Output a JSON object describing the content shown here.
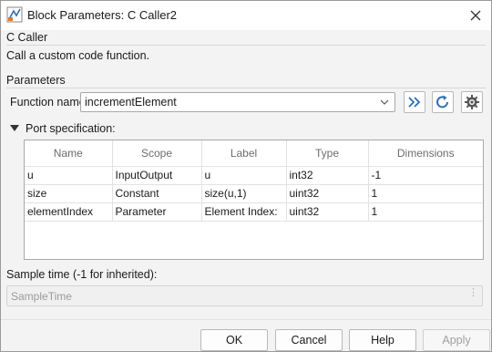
{
  "window": {
    "title": "Block Parameters: C Caller2"
  },
  "header": {
    "block_name": "C Caller",
    "description": "Call a custom code function."
  },
  "parameters": {
    "section_label": "Parameters",
    "function_name_label": "Function name:",
    "function_name_value": "incrementElement",
    "port_spec_label": "Port specification:"
  },
  "port_table": {
    "columns": [
      "Name",
      "Scope",
      "Label",
      "Type",
      "Dimensions"
    ],
    "rows": [
      [
        "u",
        "InputOutput",
        "u",
        "int32",
        "-1"
      ],
      [
        "size",
        "Constant",
        "size(u,1)",
        "uint32",
        "1"
      ],
      [
        "elementIndex",
        "Parameter",
        "Element Index:",
        "uint32",
        "1"
      ]
    ]
  },
  "sample_time": {
    "label": "Sample time (-1 for inherited):",
    "value": "SampleTime"
  },
  "buttons": {
    "ok": "OK",
    "cancel": "Cancel",
    "help": "Help",
    "apply": "Apply"
  },
  "colors": {
    "accent_blue": "#2f6fb3",
    "background": "#f3f3f3",
    "panel": "#ffffff"
  },
  "icons": {
    "app": "simulink-block-icon",
    "close": "close-icon",
    "go_to_function": "double-chevron-right-icon",
    "refresh": "refresh-icon",
    "settings": "gear-icon",
    "dropdown": "chevron-down-icon",
    "toggle": "triangle-down-icon"
  }
}
